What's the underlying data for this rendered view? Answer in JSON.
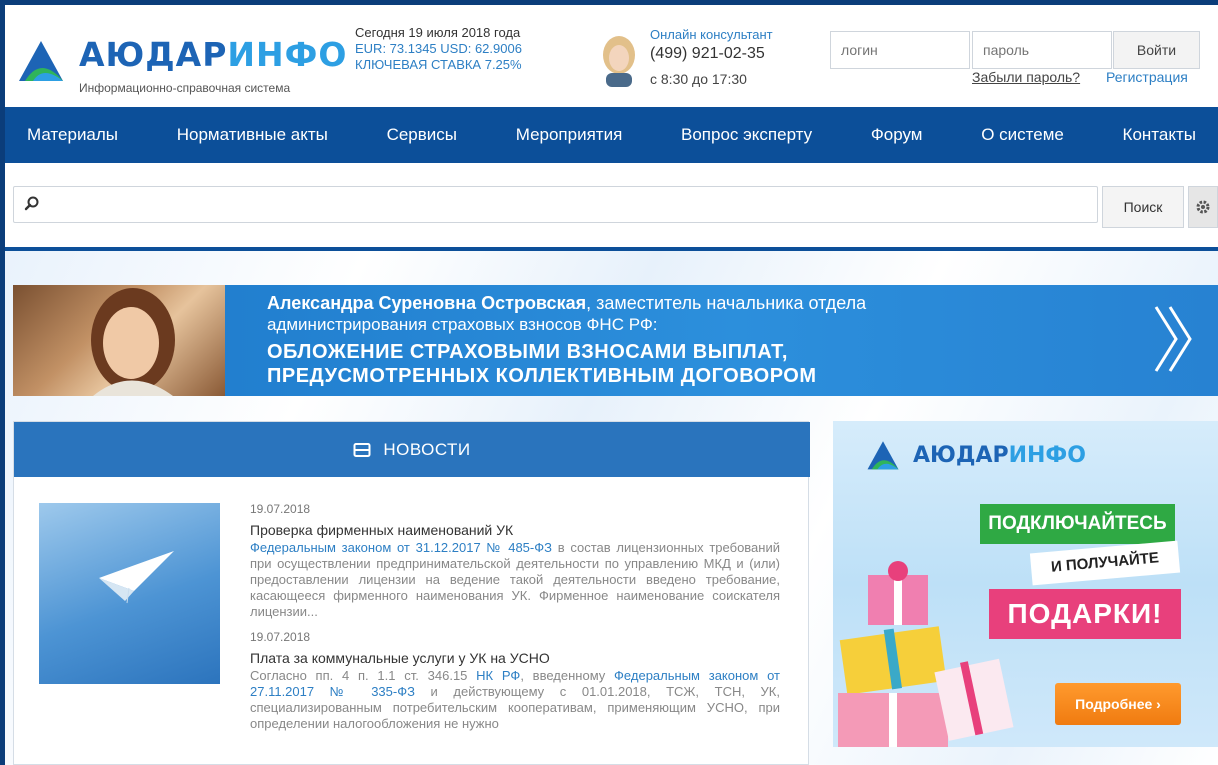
{
  "header": {
    "brand_part1": "АЮДАР",
    "brand_part2": "ИНФО",
    "brand_subtitle": "Информационно-справочная система",
    "today": "Сегодня 19 июля 2018 года",
    "rates": "EUR: 73.1345 USD: 62.9006",
    "key_rate": "КЛЮЧЕВАЯ СТАВКА 7.25%",
    "consultant_label": "Онлайн консультант",
    "consultant_phone": "(499) 921-02-35",
    "consultant_hours": "с 8:30 до 17:30",
    "login_placeholder": "логин",
    "password_placeholder": "пароль",
    "login_button": "Войти",
    "forgot_link": "Забыли пароль?",
    "register_link": "Регистрация"
  },
  "nav": {
    "items": [
      "Материалы",
      "Нормативные акты",
      "Сервисы",
      "Мероприятия",
      "Вопрос эксперту",
      "Форум",
      "О системе",
      "Контакты"
    ]
  },
  "search": {
    "placeholder": "",
    "button_label": "Поиск"
  },
  "banner": {
    "person_name": "Александра Суреновна Островская",
    "person_role_1": ", заместитель начальника отдела",
    "person_role_2": "администрирования страховых взносов ФНС РФ:",
    "headline_1": "ОБЛОЖЕНИЕ СТРАХОВЫМИ ВЗНОСАМИ ВЫПЛАТ,",
    "headline_2": "ПРЕДУСМОТРЕННЫХ КОЛЛЕКТИВНЫМ ДОГОВОРОМ"
  },
  "news": {
    "title": "НОВОСТИ",
    "items": [
      {
        "date": "19.07.2018",
        "title": "Проверка фирменных наименований УК",
        "link": "Федеральным законом от 31.12.2017 № 485-ФЗ",
        "text": " в состав лицензионных требований при осуществлении предпринимательской деятельности по управлению МКД и (или) предоставлении лицензии на ведение такой деятельности введено требование, касающееся фирменного наименования УК. Фирменное наименование соискателя лицензии..."
      },
      {
        "date": "19.07.2018",
        "title": "Плата за коммунальные услуги у УК на УСНО",
        "text_a": "Согласно пп. 4 п. 1.1 ст. 346.15 ",
        "link_a": "НК РФ",
        "text_b": ", введенному ",
        "link_b": "Федеральным законом от 27.11.2017 № 335-ФЗ",
        "text_c": " и действующему с 01.01.2018, ТСЖ, ТСН, УК, специализированным потребительским кооперативам, применяющим УСНО, при определении налогообложения не нужно"
      }
    ]
  },
  "promo": {
    "brand_part1": "АЮДАР",
    "brand_part2": "ИНФО",
    "connect": "ПОДКЛЮЧАЙТЕСЬ",
    "and_get": "И ПОЛУЧАЙТЕ",
    "gifts": "ПОДАРКИ!",
    "button": "Подробнее ›"
  },
  "colors": {
    "brand_dark": "#1d64b5",
    "brand_light": "#2d9fe3",
    "nav_bg": "#0c4f99",
    "news_head": "#2a74bd",
    "link": "#2d7fc4"
  }
}
